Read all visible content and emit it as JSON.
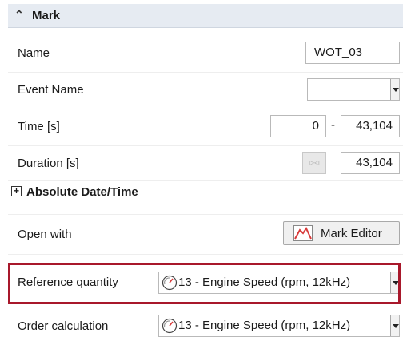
{
  "section": {
    "title": "Mark"
  },
  "name": {
    "label": "Name",
    "value": "WOT_03"
  },
  "event_name": {
    "label": "Event Name",
    "value": ""
  },
  "time": {
    "label": "Time [s]",
    "start": "0",
    "separator": "-",
    "end": "43,104"
  },
  "duration": {
    "label": "Duration [s]",
    "value": "43,104"
  },
  "absolute_datetime": {
    "label": "Absolute Date/Time"
  },
  "open_with": {
    "label": "Open with",
    "button_label": "Mark Editor"
  },
  "reference_quantity": {
    "label": "Reference quantity",
    "value": "13 - Engine Speed (rpm, 12kHz)"
  },
  "order_calculation": {
    "label": "Order calculation",
    "value": "13 - Engine Speed (rpm, 12kHz)"
  },
  "colors": {
    "header_bg": "#e6ebf2",
    "highlight": "#a8182b",
    "chart_icon": "#d83b3b"
  }
}
